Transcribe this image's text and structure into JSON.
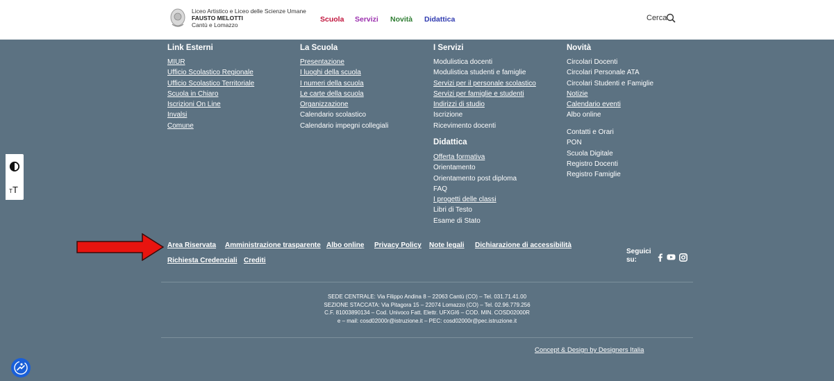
{
  "header": {
    "school_line1": "Liceo Artistico e Liceo delle Scienze Umane",
    "school_name": "FAUSTO MELOTTI",
    "school_line3": "Cantù e Lomazzo",
    "nav": [
      {
        "label": "Scuola",
        "color": "#c0143c"
      },
      {
        "label": "Servizi",
        "color": "#9b2fae"
      },
      {
        "label": "Novità",
        "color": "#2e7d32"
      },
      {
        "label": "Didattica",
        "color": "#2f3ab0"
      }
    ],
    "search_label": "Cerca"
  },
  "footer": {
    "link_esterni": {
      "heading": "Link Esterni",
      "items": [
        "MIUR",
        "Ufficio Scolastico Regionale",
        "Ufficio Scolastico Territoriale",
        "Scuola in Chiaro",
        "Iscrizioni On Line",
        "Invalsi",
        "Comune"
      ]
    },
    "la_scuola": {
      "heading": "La Scuola",
      "items": [
        "Presentazione",
        "I luoghi della scuola",
        "I numeri della scuola",
        "Le carte della scuola",
        "Organizzazione",
        "Calendario scolastico",
        "Calendario impegni collegiali"
      ]
    },
    "i_servizi": {
      "heading": "I Servizi",
      "items": [
        "Modulistica docenti",
        "Modulistica studenti e famiglie",
        "Servizi per il personale scolastico",
        "Servizi per famiglie e studenti",
        "Indirizzi di studio",
        "Iscrizione",
        "Ricevimento docenti"
      ]
    },
    "didattica": {
      "heading": "Didattica",
      "items": [
        "Offerta formativa",
        "Orientamento",
        "Orientamento post diploma",
        "FAQ",
        "I progetti delle classi",
        "Libri di Testo",
        "Esame di Stato"
      ]
    },
    "novita": {
      "heading": "Novità",
      "items": [
        "Circolari Docenti",
        "Circolari Personale ATA",
        "Circolari Studenti e Famiglie",
        "Notizie",
        "Calendario eventi",
        "Albo online"
      ],
      "items2": [
        "Contatti e Orari",
        "PON",
        "Scuola Digitale",
        "Registro Docenti",
        "Registro Famiglie"
      ]
    },
    "bottom_links": [
      "Area Riservata",
      "Amministrazione trasparente",
      "Albo online",
      "Privacy Policy",
      "Note legali",
      "Dichiarazione di accessibilità",
      "Richiesta Credenziali",
      "Crediti"
    ],
    "follow_label": "Seguici su:",
    "social_icons": [
      "facebook-icon",
      "youtube-icon",
      "instagram-icon"
    ],
    "address": [
      "SEDE CENTRALE: Via Filippo Andina 8 – 22063 Cantù (CO) – Tel. 031.71.41.00",
      "SEZIONE STACCATA: Via Pitagora 15 – 22074 Lomazzo (CO) – Tel. 02.96.779.256",
      "C.F. 81003890134 – Cod. Univoco Fatt. Elettr. UFXGI6 – COD. MIN. COSD02000R",
      "e – mail: cosd02000r@istruzione.it – PEC: cosd02000r@pec.istruzione.it"
    ],
    "credits": "Concept & Design by Designers Italia"
  },
  "colors": {
    "footer_bg": "#5c7282",
    "arrow": "#e8140f",
    "a11y_button": "#1a5fd8"
  }
}
